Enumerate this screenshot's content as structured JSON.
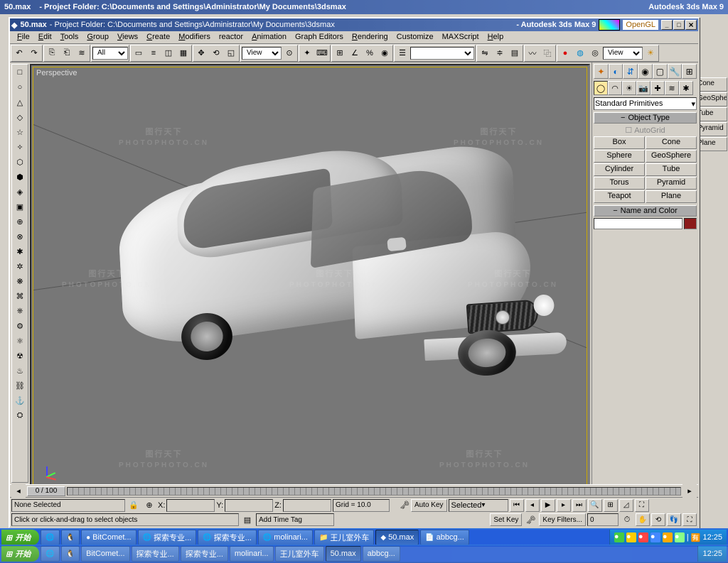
{
  "bg": {
    "title_file": "50.max",
    "title_folder": "- Project Folder: C:\\Documents and Settings\\Administrator\\My Documents\\3dsmax",
    "title_app": "Autodesk 3ds Max 9",
    "rpanel": [
      "Cone",
      "GeoSphe",
      "Tube",
      "Pyramid",
      "Plane"
    ]
  },
  "window": {
    "file": "50.max",
    "folder": "- Project Folder: C:\\Documents and Settings\\Administrator\\My Documents\\3dsmax",
    "app": "- Autodesk 3ds Max 9",
    "renderer": "OpenGL",
    "min": "_",
    "max": "□",
    "close": "×"
  },
  "menu": [
    "File",
    "Edit",
    "Tools",
    "Group",
    "Views",
    "Create",
    "Modifiers",
    "reactor",
    "Animation",
    "Graph Editors",
    "Rendering",
    "Customize",
    "MAXScript",
    "Help"
  ],
  "toolbar": {
    "sel_all": "All",
    "view1": "View",
    "view2": "View"
  },
  "viewport": {
    "label": "Perspective"
  },
  "panel": {
    "dropdown": "Standard Primitives",
    "rollout1": "Object Type",
    "autogrid": "AutoGrid",
    "objects": [
      "Box",
      "Cone",
      "Sphere",
      "GeoSphere",
      "Cylinder",
      "Tube",
      "Torus",
      "Pyramid",
      "Teapot",
      "Plane"
    ],
    "rollout2": "Name and Color"
  },
  "timeline": {
    "pos": "0 / 100"
  },
  "status": {
    "selection": "None Selected",
    "x": "X:",
    "y": "Y:",
    "z": "Z:",
    "grid": "Grid = 10.0",
    "autokey": "Auto Key",
    "setkey": "Set Key",
    "selected": "Selected",
    "keyfilters": "Key Filters...",
    "prompt": "Click or click-and-drag to select objects",
    "addtag": "Add Time Tag"
  },
  "taskbar": {
    "start": "开始",
    "items": [
      "",
      "BitComet...",
      "探索专业...",
      "探索专业...",
      "molinari...",
      "王儿室外车",
      "50.max",
      "abbcg..."
    ],
    "time": "12:25"
  },
  "watermark": {
    "text": "图行天下",
    "sub": "PHOTOPHOTO.CN"
  }
}
